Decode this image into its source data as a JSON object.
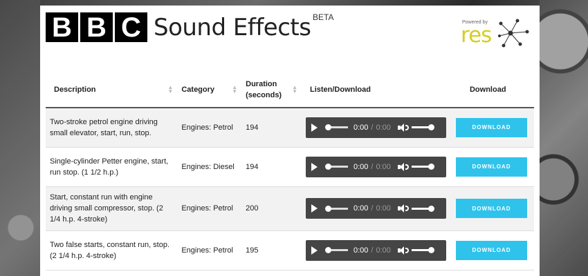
{
  "header": {
    "logo_letters": [
      "B",
      "B",
      "C"
    ],
    "title": "Sound Effects",
    "beta": "BETA",
    "powered_by": "Powered by",
    "partner": "res"
  },
  "table": {
    "columns": [
      "Description",
      "Category",
      "Duration (seconds)",
      "Listen/Download",
      "Download"
    ],
    "rows": [
      {
        "description": "Two-stroke petrol engine driving small elevator, start, run, stop.",
        "category": "Engines: Petrol",
        "duration": "194",
        "time_current": "0:00",
        "time_total": "0:00",
        "download_label": "DOWNLOAD"
      },
      {
        "description": "Single-cylinder Petter engine, start, run stop. (1 1/2 h.p.)",
        "category": "Engines: Diesel",
        "duration": "194",
        "time_current": "0:00",
        "time_total": "0:00",
        "download_label": "DOWNLOAD"
      },
      {
        "description": "Start, constant run with engine driving small compressor, stop. (2 1/4 h.p. 4-stroke)",
        "category": "Engines: Petrol",
        "duration": "200",
        "time_current": "0:00",
        "time_total": "0:00",
        "download_label": "DOWNLOAD"
      },
      {
        "description": "Two false starts, constant run, stop. (2 1/4 h.p. 4-stroke)",
        "category": "Engines: Petrol",
        "duration": "195",
        "time_current": "0:00",
        "time_total": "0:00",
        "download_label": "DOWNLOAD"
      }
    ]
  },
  "colors": {
    "accent": "#2fc3ec",
    "player_bg": "#454545",
    "res_yellow": "#d4cf1f"
  }
}
